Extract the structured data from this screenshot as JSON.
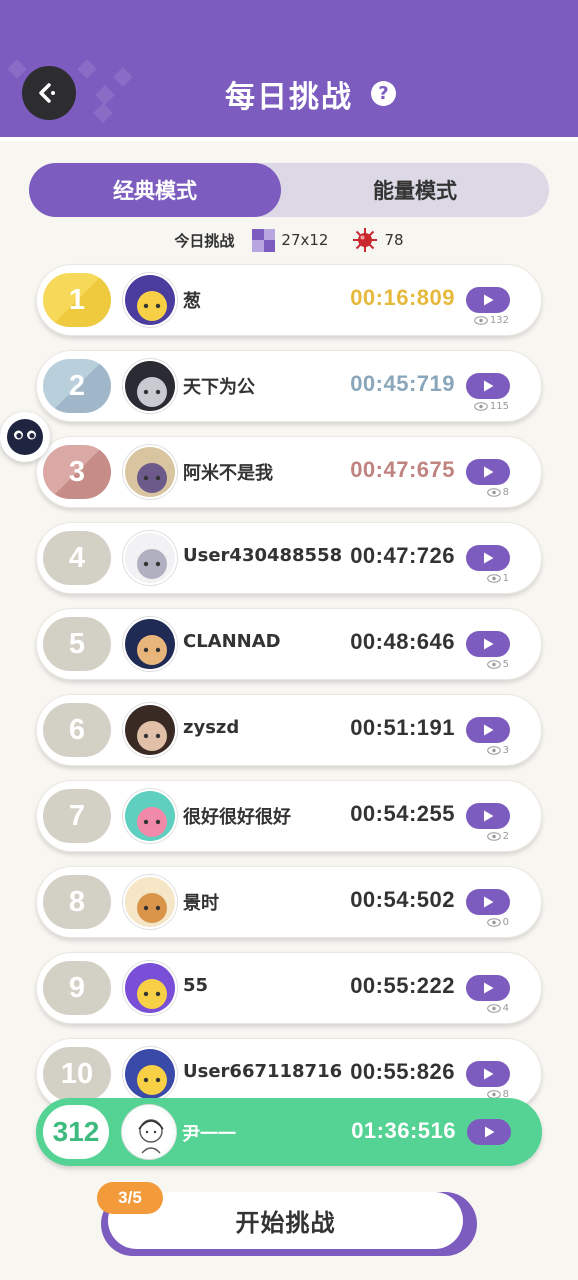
{
  "header": {
    "title": "每日挑战",
    "back_icon": "back-arrow-icon",
    "help_label": "?",
    "bg_color": "#7c5cbf"
  },
  "tabs": [
    {
      "label": "经典模式",
      "active": true
    },
    {
      "label": "能量模式",
      "active": false
    }
  ],
  "info": {
    "label": "今日挑战",
    "board_size": "27x12",
    "mines": "78"
  },
  "leaderboard": [
    {
      "rank": "1",
      "name": "葱",
      "time": "00:16:809",
      "views": "132",
      "time_color": "#e6b93c",
      "avatar_colors": [
        "#4a3d9e",
        "#f7d046"
      ]
    },
    {
      "rank": "2",
      "name": "天下为公",
      "time": "00:45:719",
      "views": "115",
      "time_color": "#8aa6ba",
      "avatar_colors": [
        "#2b2b33",
        "#c9c9d2"
      ]
    },
    {
      "rank": "3",
      "name": "阿米不是我",
      "time": "00:47:675",
      "views": "8",
      "time_color": "#c08480",
      "avatar_colors": [
        "#d8c5a0",
        "#6b5a8a"
      ]
    },
    {
      "rank": "4",
      "name": "User430488558",
      "time": "00:47:726",
      "views": "1",
      "time_color": "#333333",
      "avatar_colors": [
        "#f2f2f5",
        "#b0b0c0"
      ]
    },
    {
      "rank": "5",
      "name": "CLANNAD",
      "time": "00:48:646",
      "views": "5",
      "time_color": "#333333",
      "avatar_colors": [
        "#1f2a55",
        "#e8b57a"
      ]
    },
    {
      "rank": "6",
      "name": "zyszd",
      "time": "00:51:191",
      "views": "3",
      "time_color": "#333333",
      "avatar_colors": [
        "#3a2a24",
        "#e0c0a8"
      ]
    },
    {
      "rank": "7",
      "name": "很好很好很好",
      "time": "00:54:255",
      "views": "2",
      "time_color": "#333333",
      "avatar_colors": [
        "#5fd0c0",
        "#f08aa8"
      ]
    },
    {
      "rank": "8",
      "name": "景时",
      "time": "00:54:502",
      "views": "0",
      "time_color": "#333333",
      "avatar_colors": [
        "#f5e6c8",
        "#d9954a"
      ]
    },
    {
      "rank": "9",
      "name": "55",
      "time": "00:55:222",
      "views": "4",
      "time_color": "#333333",
      "avatar_colors": [
        "#7a4fd8",
        "#f7d046"
      ]
    },
    {
      "rank": "10",
      "name": "User667118716",
      "time": "00:55:826",
      "views": "8",
      "time_color": "#333333",
      "avatar_colors": [
        "#3a4aa8",
        "#f7d046"
      ]
    }
  ],
  "my_entry": {
    "rank": "312",
    "name": "尹一一",
    "time": "01:36:516"
  },
  "start": {
    "label": "开始挑战",
    "count": "3/5"
  }
}
